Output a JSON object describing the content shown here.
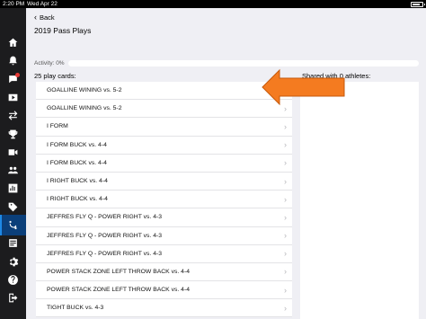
{
  "status_bar": {
    "time": "2:20 PM",
    "date": "Wed Apr 22",
    "battery_level": 0.8
  },
  "sidebar": {
    "items": [
      {
        "icon": "home-icon",
        "active": false
      },
      {
        "icon": "bell-icon",
        "active": false
      },
      {
        "icon": "chat-icon",
        "active": false,
        "badge": true
      },
      {
        "icon": "video-icon",
        "active": false
      },
      {
        "icon": "swap-icon",
        "active": false
      },
      {
        "icon": "trophy-icon",
        "active": false
      },
      {
        "icon": "camera-icon",
        "active": false
      },
      {
        "icon": "users-icon",
        "active": false
      },
      {
        "icon": "chart-icon",
        "active": false
      },
      {
        "icon": "tag-icon",
        "active": false
      },
      {
        "icon": "playbook-icon",
        "active": true
      },
      {
        "icon": "cards-icon",
        "active": false
      },
      {
        "icon": "gear-icon",
        "active": false
      },
      {
        "icon": "question-icon",
        "active": false
      },
      {
        "icon": "logout-icon",
        "active": false
      }
    ]
  },
  "header": {
    "back_label": "Back",
    "title": "2019 Pass Plays"
  },
  "activity": {
    "label": "Activity: 0%",
    "value": 0
  },
  "list": {
    "count_label": "25 play cards:",
    "items": [
      "GOALLINE WINING vs. 5-2",
      "GOALLINE WINING vs. 5-2",
      "I FORM",
      "I FORM BUCK vs. 4-4",
      "I FORM BUCK vs. 4-4",
      "I RIGHT BUCK vs. 4-4",
      "I RIGHT BUCK vs. 4-4",
      "JEFFRES FLY Q - POWER RIGHT vs. 4-3",
      "JEFFRES FLY Q - POWER RIGHT vs. 4-3",
      "JEFFRES FLY Q - POWER RIGHT vs. 4-3",
      "POWER STACK ZONE LEFT THROW BACK vs. 4-4",
      "POWER STACK ZONE LEFT THROW BACK vs. 4-4",
      "TIGHT BUCK vs. 4-3"
    ]
  },
  "shared": {
    "label": "Shared with 0 athletes:"
  },
  "colors": {
    "accent": "#1e88e5",
    "pointer": "#f47b20",
    "sidebar": "#1c1c1e",
    "background": "#efeff4"
  }
}
